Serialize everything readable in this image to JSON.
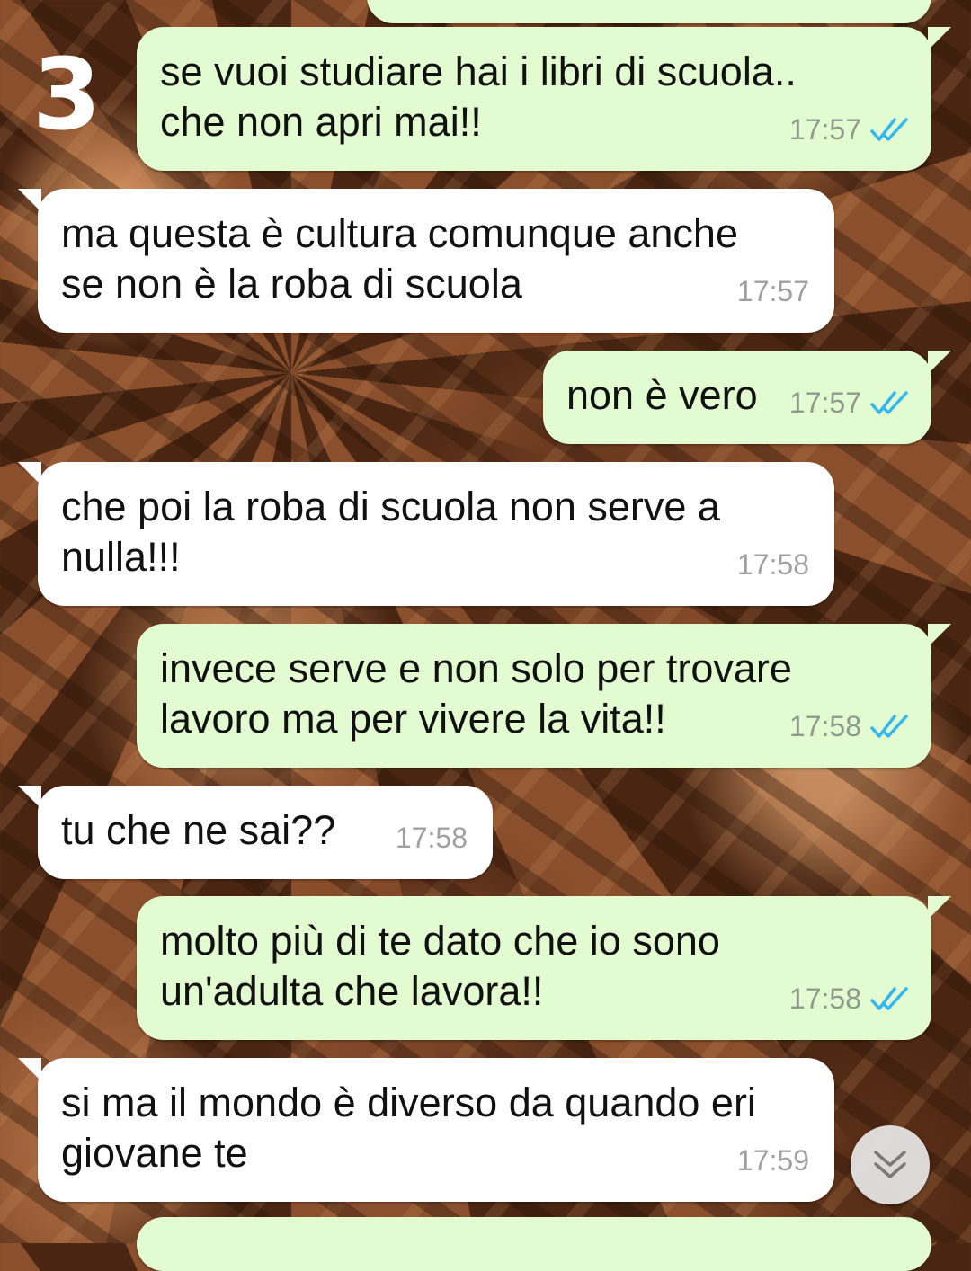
{
  "overlay": {
    "badge": "3"
  },
  "messages": [
    {
      "direction": "out",
      "text": "se vuoi studiare hai i libri di scuola..\nche non apri mai!!",
      "time": "17:57",
      "status": "read"
    },
    {
      "direction": "in",
      "text": "ma questa è cultura comunque anche\nse non è la roba di scuola",
      "time": "17:57"
    },
    {
      "direction": "out",
      "text": "non è vero",
      "time": "17:57",
      "status": "read"
    },
    {
      "direction": "in",
      "text": "che poi la roba di scuola non serve a\nnulla!!!",
      "time": "17:58"
    },
    {
      "direction": "out",
      "text": "invece serve e non solo per trovare\nlavoro ma per vivere la vita!!",
      "time": "17:58",
      "status": "read"
    },
    {
      "direction": "in",
      "text": "tu che ne sai??",
      "time": "17:58"
    },
    {
      "direction": "out",
      "text": "molto più di te dato che io sono\nun'adulta che lavora!!",
      "time": "17:58",
      "status": "read"
    },
    {
      "direction": "in",
      "text": "si ma il mondo è diverso da quando eri\ngiovane te",
      "time": "17:59"
    }
  ],
  "colors": {
    "outgoing_bubble": "#e3fbd0",
    "incoming_bubble": "#ffffff",
    "read_ticks": "#34b7f1"
  },
  "controls": {
    "scroll_down_icon": "double-chevron-down-icon"
  }
}
